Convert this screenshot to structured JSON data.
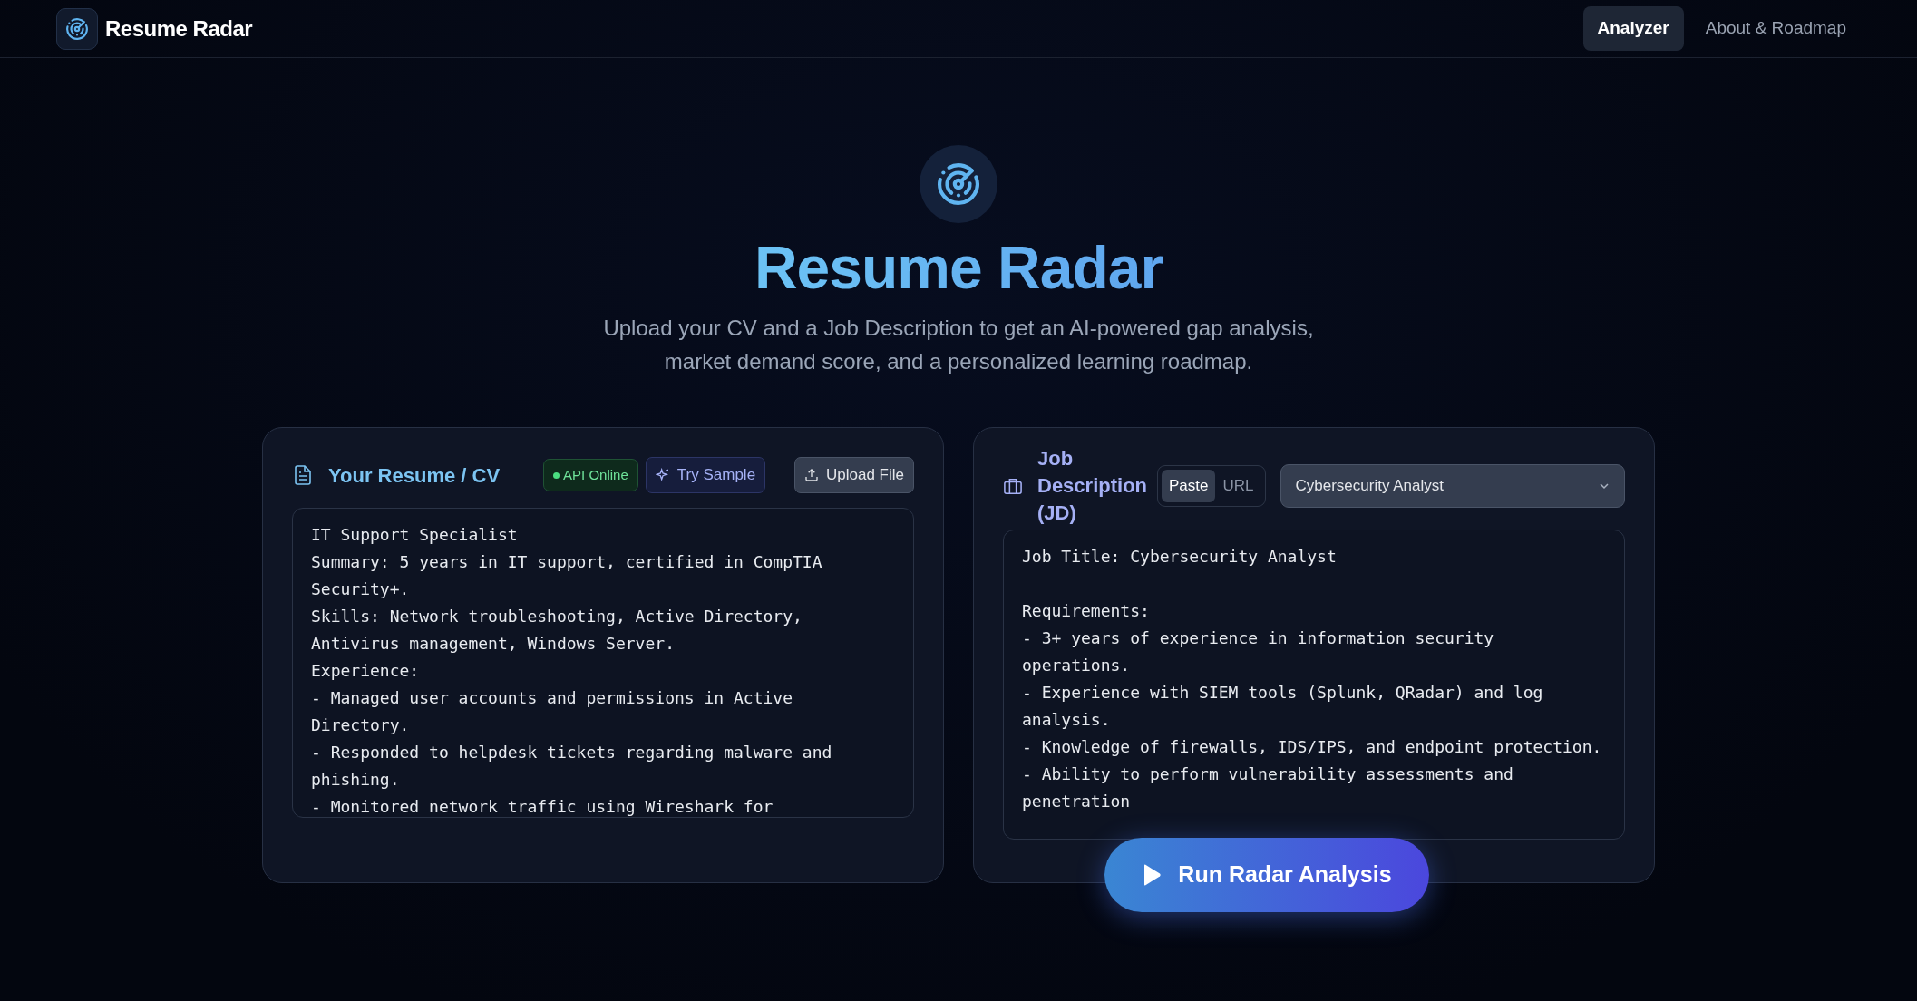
{
  "navbar": {
    "brand": "Resume Radar",
    "links": [
      {
        "label": "Analyzer",
        "selected": true
      },
      {
        "label": "About & Roadmap",
        "selected": false
      }
    ]
  },
  "hero": {
    "title": "Resume Radar",
    "subtitle": "Upload your CV and a Job Description to get an AI-powered gap analysis, market demand score, and a personalized learning roadmap."
  },
  "resume_card": {
    "title": "Your Resume / CV",
    "status": {
      "label": "API Online",
      "online": true
    },
    "sample_button": "Try Sample",
    "upload_button": "Upload File",
    "text": "IT Support Specialist\nSummary: 5 years in IT support, certified in CompTIA Security+.\nSkills: Network troubleshooting, Active Directory, Antivirus management, Windows Server.\nExperience:\n- Managed user accounts and permissions in Active Directory.\n- Responded to helpdesk tickets regarding malware and phishing.\n- Monitored network traffic using Wireshark for"
  },
  "jd_card": {
    "title": "Job Description (JD)",
    "modes": [
      {
        "label": "Paste",
        "selected": true
      },
      {
        "label": "URL",
        "selected": false
      }
    ],
    "role_select": "Cybersecurity Analyst",
    "text": "Job Title: Cybersecurity Analyst\n\nRequirements:\n- 3+ years of experience in information security operations.\n- Experience with SIEM tools (Splunk, QRadar) and log analysis.\n- Knowledge of firewalls, IDS/IPS, and endpoint protection.\n- Ability to perform vulnerability assessments and penetration"
  },
  "run_button": "Run Radar Analysis"
}
